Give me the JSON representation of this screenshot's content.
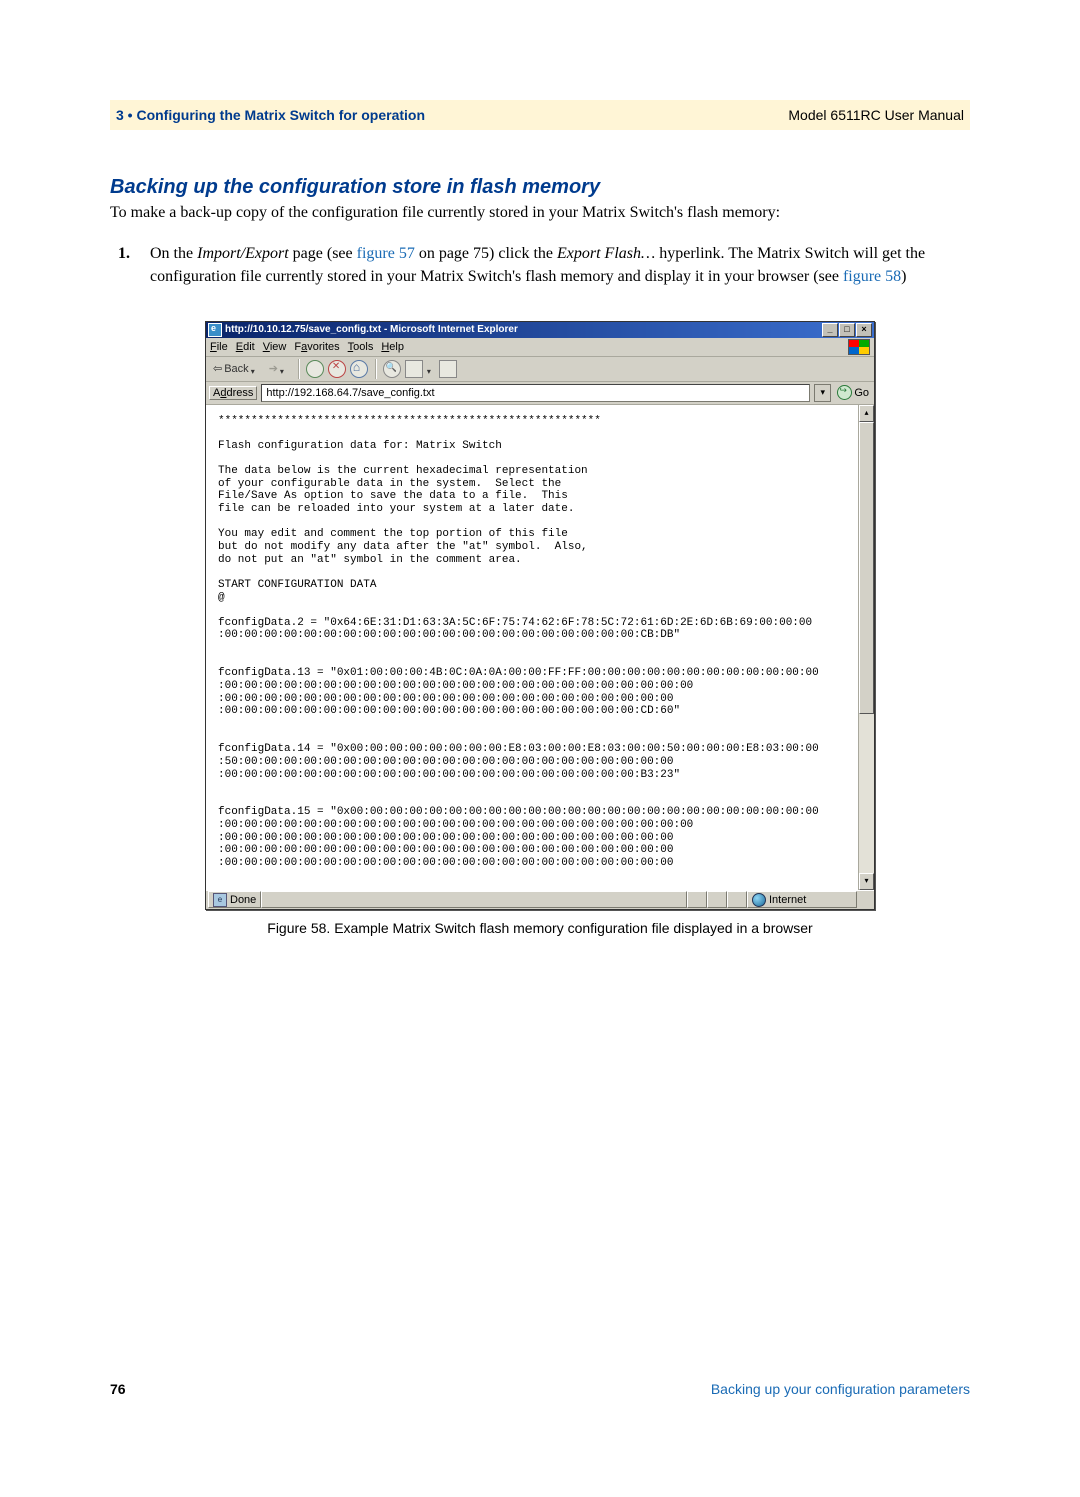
{
  "header": {
    "chapter": "3 • Configuring the Matrix Switch for operation",
    "model": "Model 6511RC User Manual"
  },
  "section_heading": "Backing up the configuration store in flash memory",
  "intro": "To make a back-up copy of the configuration file currently stored in your Matrix Switch's flash memory:",
  "step1": {
    "marker": "1.",
    "pre1": "On the ",
    "emp1": "Import/Export",
    "mid1": " page (see ",
    "link1": "figure 57",
    "mid2": " on page 75) click the ",
    "emp2": "Export Flash…",
    "post1": " hyperlink. The Matrix Switch will get the configuration file currently stored in your Matrix Switch's flash memory and display it in your browser (see ",
    "link2": "figure 58",
    "close": ")"
  },
  "ie": {
    "title": "http://10.10.12.75/save_config.txt - Microsoft Internet Explorer",
    "menus": {
      "file": "File",
      "edit": "Edit",
      "view": "View",
      "favorites": "Favorites",
      "tools": "Tools",
      "help": "Help"
    },
    "toolbar": {
      "back": "Back"
    },
    "address_label": "Address",
    "address_value": "http://192.168.64.7/save_config.txt",
    "go": "Go",
    "body": "**********************************************************\n\nFlash configuration data for: Matrix Switch\n\nThe data below is the current hexadecimal representation\nof your configurable data in the system.  Select the\nFile/Save As option to save the data to a file.  This\nfile can be reloaded into your system at a later date.\n\nYou may edit and comment the top portion of this file\nbut do not modify any data after the \"at\" symbol.  Also,\ndo not put an \"at\" symbol in the comment area.\n\nSTART CONFIGURATION DATA\n@\n\nfconfigData.2 = \"0x64:6E:31:D1:63:3A:5C:6F:75:74:62:6F:78:5C:72:61:6D:2E:6D:6B:69:00:00:00\n:00:00:00:00:00:00:00:00:00:00:00:00:00:00:00:00:00:00:00:00:00:CB:DB\"\n\n\nfconfigData.13 = \"0x01:00:00:00:4B:0C:0A:0A:00:00:FF:FF:00:00:00:00:00:00:00:00:00:00:00:00\n:00:00:00:00:00:00:00:00:00:00:00:00:00:00:00:00:00:00:00:00:00:00:00:00\n:00:00:00:00:00:00:00:00:00:00:00:00:00:00:00:00:00:00:00:00:00:00:00\n:00:00:00:00:00:00:00:00:00:00:00:00:00:00:00:00:00:00:00:00:00:CD:60\"\n\n\nfconfigData.14 = \"0x00:00:00:00:00:00:00:00:E8:03:00:00:E8:03:00:00:50:00:00:00:E8:03:00:00\n:50:00:00:00:00:00:00:00:00:00:00:00:00:00:00:00:00:00:00:00:00:00:00\n:00:00:00:00:00:00:00:00:00:00:00:00:00:00:00:00:00:00:00:00:00:B3:23\"\n\n\nfconfigData.15 = \"0x00:00:00:00:00:00:00:00:00:00:00:00:00:00:00:00:00:00:00:00:00:00:00:00\n:00:00:00:00:00:00:00:00:00:00:00:00:00:00:00:00:00:00:00:00:00:00:00:00\n:00:00:00:00:00:00:00:00:00:00:00:00:00:00:00:00:00:00:00:00:00:00:00\n:00:00:00:00:00:00:00:00:00:00:00:00:00:00:00:00:00:00:00:00:00:00:00\n:00:00:00:00:00:00:00:00:00:00:00:00:00:00:00:00:00:00:00:00:00:00:00",
    "status_done": "Done",
    "status_zone": "Internet"
  },
  "caption": "Figure 58. Example Matrix Switch flash memory configuration file displayed in a browser",
  "footer": {
    "page": "76",
    "link": "Backing up your configuration parameters"
  }
}
